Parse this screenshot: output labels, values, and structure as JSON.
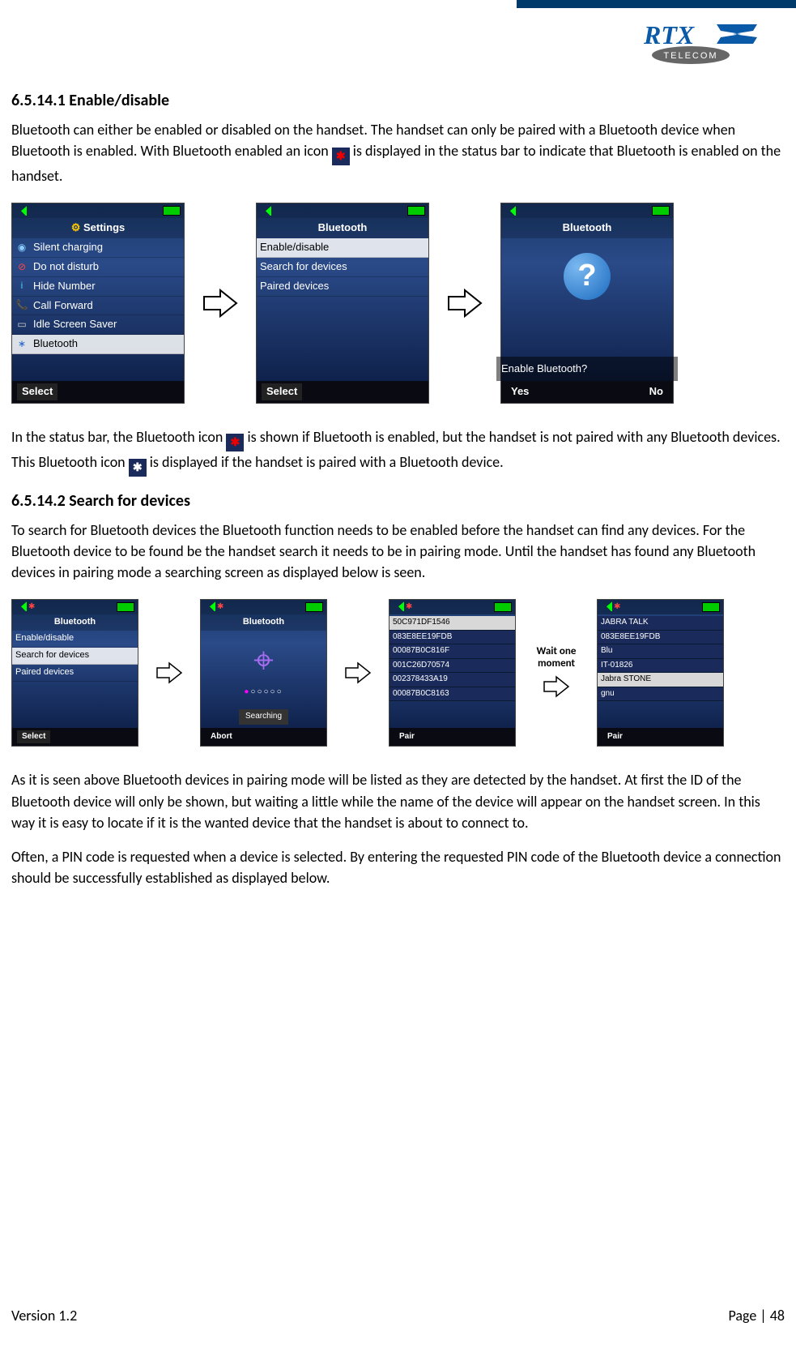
{
  "logo": {
    "brand_main": "RTX",
    "brand_sub": "TELECOM"
  },
  "sec1": {
    "heading": "6.5.14.1 Enable/disable",
    "p1a": "Bluetooth can either be enabled or disabled on the handset. The handset can only be paired with a Bluetooth device when Bluetooth is enabled. With Bluetooth enabled an icon ",
    "p1b": " is displayed in the status bar to indicate that Bluetooth is enabled on the handset.",
    "p2a": "In the status bar, the Bluetooth icon ",
    "p2b": " is shown if Bluetooth is enabled, but the handset is not paired with any Bluetooth devices. This Bluetooth icon ",
    "p2c": " is displayed if the handset is paired with a Bluetooth device."
  },
  "sec2": {
    "heading": "6.5.14.2 Search for devices",
    "p1": "To search for Bluetooth devices the Bluetooth function needs to be enabled before the handset can find any devices. For the Bluetooth device to be found be the handset search it needs to be in pairing mode. Until the handset has found any Bluetooth devices in pairing mode a searching screen as displayed below is seen.",
    "p2": "As it is seen above Bluetooth devices in pairing mode will be listed as they are detected by the handset. At first the ID of the Bluetooth device will only be shown, but waiting a little while the name of the device will appear on the handset screen. In this way it is easy to locate if it is the wanted device that the handset is about to connect to.",
    "p3": "Often, a PIN code is requested when a device is selected. By entering the requested PIN code of the Bluetooth device a connection should be successfully established as displayed below."
  },
  "phone_settings": {
    "title": "Settings",
    "items": [
      "Silent charging",
      "Do not disturb",
      "Hide Number",
      "Call Forward",
      "Idle Screen Saver",
      "Bluetooth"
    ],
    "select": "Select"
  },
  "phone_bt_menu": {
    "title": "Bluetooth",
    "items": [
      "Enable/disable",
      "Search for devices",
      "Paired devices"
    ],
    "select": "Select"
  },
  "phone_dialog": {
    "title": "Bluetooth",
    "prompt": "Enable Bluetooth?",
    "yes": "Yes",
    "no": "No"
  },
  "phone_searching": {
    "title": "Bluetooth",
    "label": "Searching",
    "abort": "Abort"
  },
  "phone_ids": {
    "items": [
      "50C971DF1546",
      "083E8EE19FDB",
      "00087B0C816F",
      "001C26D70574",
      "002378433A19",
      "00087B0C8163"
    ],
    "pair": "Pair"
  },
  "phone_names": {
    "items": [
      "JABRA TALK",
      "083E8EE19FDB",
      "Blu",
      "IT-01826",
      "Jabra STONE",
      "gnu"
    ],
    "pair": "Pair"
  },
  "annot": "Wait one moment",
  "footer": {
    "version": "Version 1.2",
    "page": "Page | 48"
  }
}
